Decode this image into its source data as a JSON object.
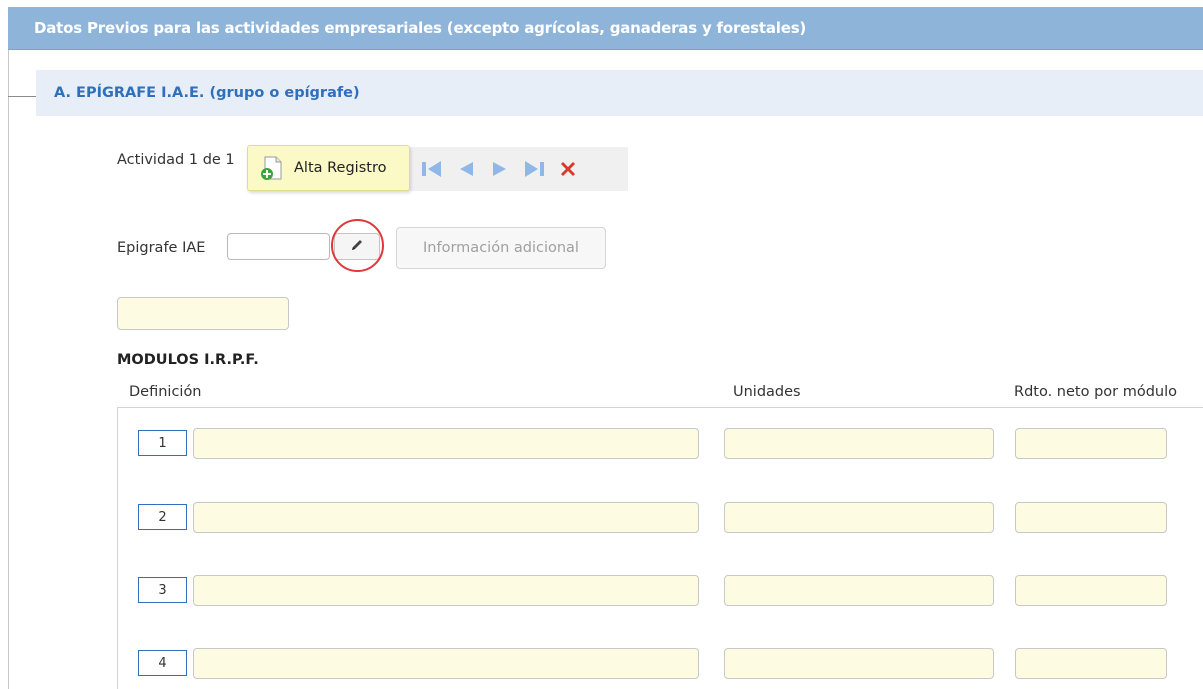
{
  "header": {
    "title": "Datos Previos para las actividades empresariales (excepto agrícolas, ganaderas y forestales)"
  },
  "section": {
    "title": "A. EPÍGRAFE I.A.E. (grupo o epígrafe)"
  },
  "activity": {
    "label": "Actividad 1 de 1",
    "alta_button_label": "Alta Registro",
    "nav_icons": [
      "first-record-icon",
      "previous-record-icon",
      "next-record-icon",
      "last-record-icon",
      "delete-record-icon"
    ]
  },
  "epigrafe": {
    "label": "Epigrafe IAE",
    "value": "",
    "edit_icon": "pencil-icon",
    "info_button_label": "Información adicional",
    "description_value": ""
  },
  "modulos": {
    "title": "MODULOS I.R.P.F.",
    "columns": [
      "Definición",
      "Unidades",
      "Rdto. neto por módulo"
    ],
    "rows": [
      {
        "number": "1",
        "definicion": "",
        "unidades": "",
        "rdto": ""
      },
      {
        "number": "2",
        "definicion": "",
        "unidades": "",
        "rdto": ""
      },
      {
        "number": "3",
        "definicion": "",
        "unidades": "",
        "rdto": ""
      },
      {
        "number": "4",
        "definicion": "",
        "unidades": "",
        "rdto": ""
      }
    ]
  },
  "colors": {
    "header_bg": "#8fb4d9",
    "section_bg": "#e7eef7",
    "section_text": "#2f6fbb",
    "input_yellow": "#fdfbe1",
    "highlight_red": "#e0383a",
    "delete_red": "#d9382b",
    "nav_blue": "#8fb8e8"
  }
}
